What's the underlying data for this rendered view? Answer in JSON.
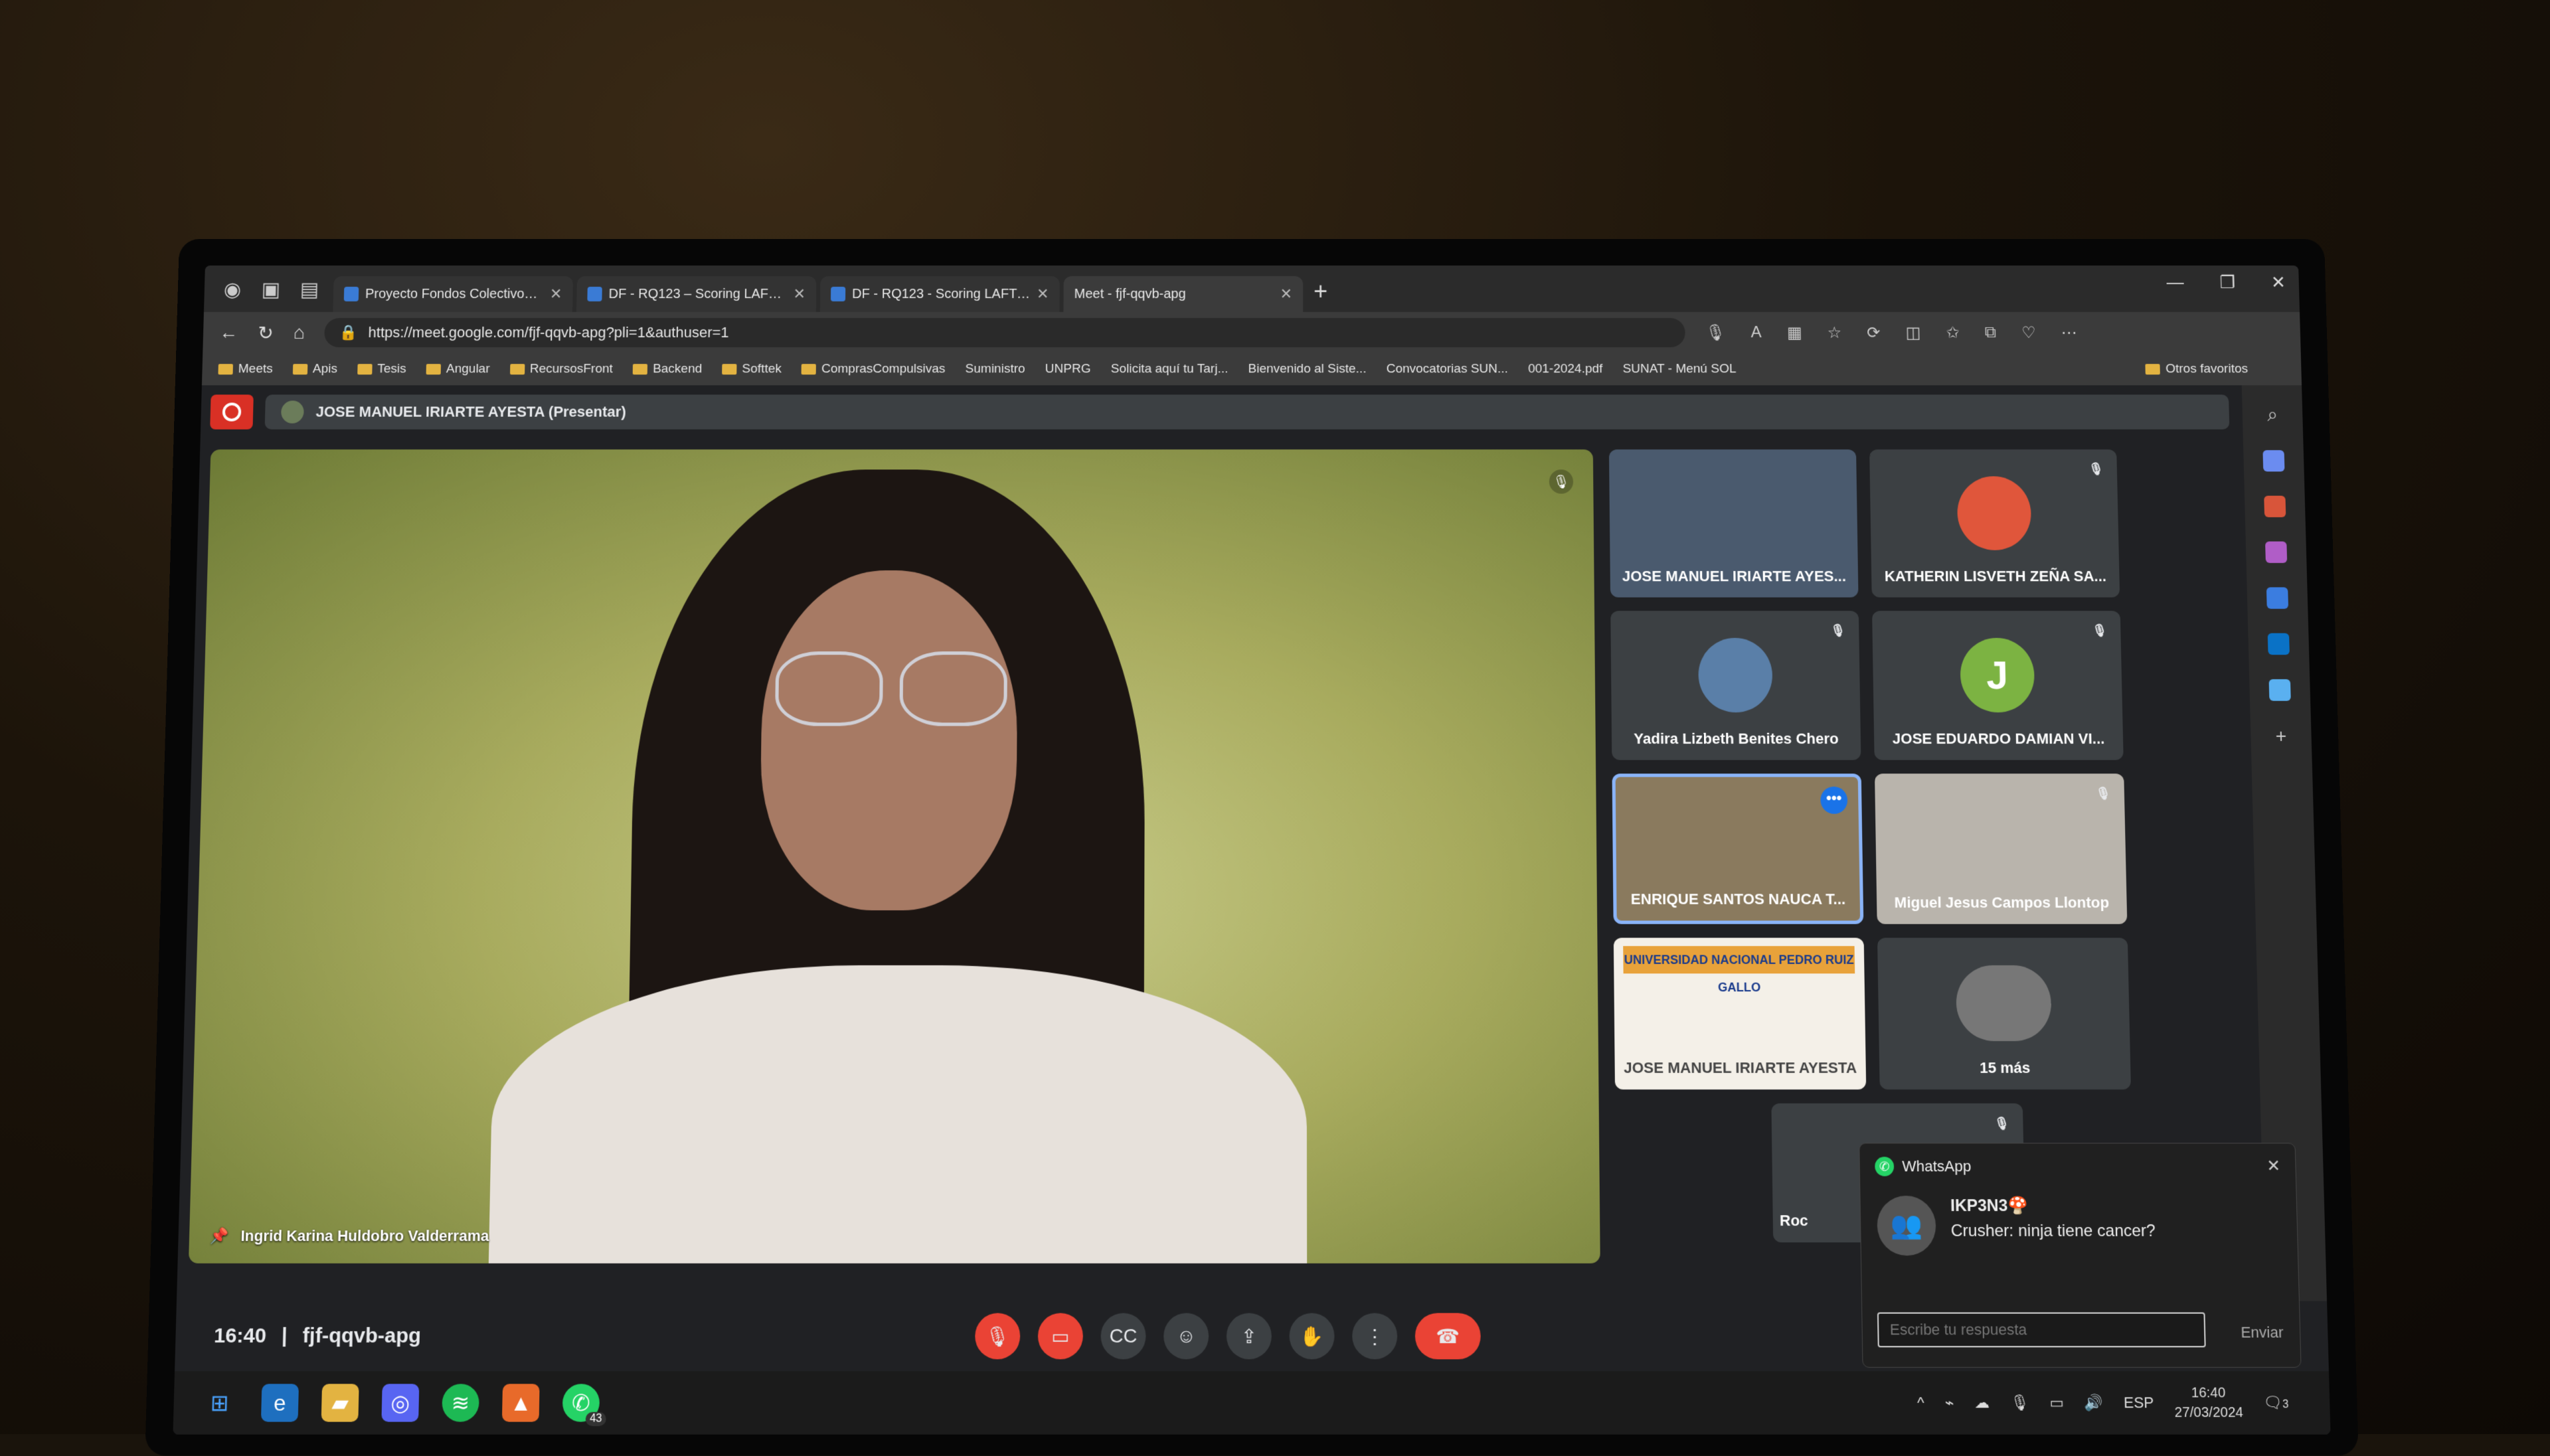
{
  "browser": {
    "tabs": [
      {
        "title": "Proyecto Fondos Colectivos - Do",
        "active": false,
        "favicon": "planner"
      },
      {
        "title": "DF - RQ123 – Scoring LAFT - Cal",
        "active": false,
        "favicon": "word"
      },
      {
        "title": "DF - RQ123 - Scoring LAFT - Cal",
        "active": false,
        "favicon": "word"
      },
      {
        "title": "Meet - fjf-qqvb-apg",
        "active": true,
        "favicon": "meet"
      }
    ],
    "url": "https://meet.google.com/fjf-qqvb-apg?pli=1&authuser=1",
    "bookmarks": [
      "Meets",
      "Apis",
      "Tesis",
      "Angular",
      "RecursosFront",
      "Backend",
      "Softtek",
      "ComprasCompulsivas",
      "Suministro",
      "UNPRG",
      "Solicita aquí tu Tarj...",
      "Bienvenido al Siste...",
      "Convocatorias SUN...",
      "001-2024.pdf",
      "SUNAT - Menú SOL"
    ],
    "other_bookmarks": "Otros favoritos"
  },
  "meet": {
    "presenter_label": "JOSE MANUEL IRIARTE AYESTA (Presentar)",
    "main_participant": "Ingrid Karina Huldobro Valderrama",
    "participants": [
      {
        "name": "JOSE MANUEL IRIARTE AYES...",
        "type": "video"
      },
      {
        "name": "KATHERIN LISVETH ZEÑA SA...",
        "type": "avatar",
        "muted": true
      },
      {
        "name": "Yadira Lizbeth Benites Chero",
        "type": "avatar",
        "muted": true
      },
      {
        "name": "JOSE EDUARDO DAMIAN VI...",
        "type": "letter",
        "letter": "J",
        "color": "#7cb342",
        "muted": true
      },
      {
        "name": "ENRIQUE SANTOS NAUCA T...",
        "type": "video",
        "speaking": true
      },
      {
        "name": "Miguel Jesus Campos Llontop",
        "type": "video",
        "muted": true
      },
      {
        "name": "JOSE MANUEL IRIARTE AYESTA",
        "type": "presentation"
      },
      {
        "name": "15 más",
        "type": "more"
      }
    ],
    "partial_tile_name": "Roc",
    "time": "16:40",
    "separator": "|",
    "meeting_code": "fjf-qqvb-apg",
    "presentation_header": "UNIVERSIDAD NACIONAL PEDRO RUIZ GALLO"
  },
  "whatsapp": {
    "app": "WhatsApp",
    "chat": "IKP3N3🍄",
    "message": "Crusher: ninja tiene cancer?",
    "placeholder": "Escribe tu respuesta",
    "send": "Enviar"
  },
  "taskbar": {
    "whatsapp_badge": "43",
    "language": "ESP",
    "time": "16:40",
    "date": "27/03/2024",
    "notifications": "3"
  }
}
